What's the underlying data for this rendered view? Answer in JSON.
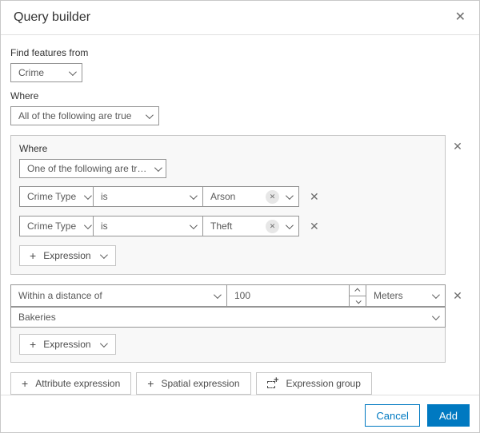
{
  "dialog": {
    "title": "Query builder"
  },
  "icons": {
    "close": "✕",
    "plus": "+"
  },
  "find_features": {
    "label": "Find features from",
    "value": "Crime"
  },
  "where": {
    "label": "Where",
    "value": "All of the following are true"
  },
  "group1": {
    "label": "Where",
    "operator_value": "One of the following are tr…",
    "rows": [
      {
        "field": "Crime Type",
        "operator": "is",
        "value": "Arson"
      },
      {
        "field": "Crime Type",
        "operator": "is",
        "value": "Theft"
      }
    ],
    "add_expression_label": "Expression"
  },
  "group2": {
    "mode_value": "Within a distance of",
    "distance_value": "100",
    "unit_value": "Meters",
    "layer_value": "Bakeries",
    "add_expression_label": "Expression"
  },
  "actions": {
    "attribute_expression": "Attribute expression",
    "spatial_expression": "Spatial expression",
    "expression_group": "Expression group"
  },
  "footer": {
    "cancel": "Cancel",
    "add": "Add"
  },
  "colors": {
    "accent": "#0079c1"
  }
}
